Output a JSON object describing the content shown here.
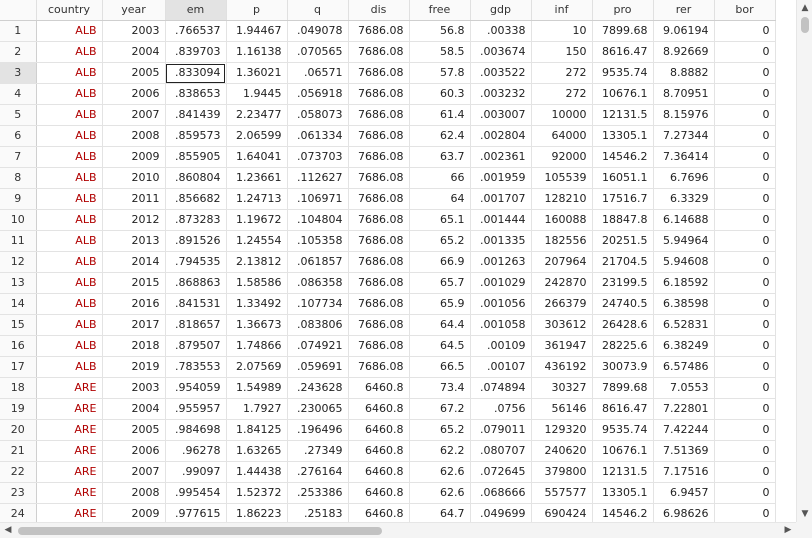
{
  "columns": [
    "country",
    "year",
    "em",
    "p",
    "q",
    "dis",
    "free",
    "gdp",
    "inf",
    "pro",
    "rer",
    "bor"
  ],
  "selected_column": "em",
  "selected_row": 3,
  "active_cell": {
    "row": 3,
    "column": "em"
  },
  "string_color": "#b00000",
  "rows": [
    [
      "1",
      "ALB",
      "2003",
      ".766537",
      "1.94467",
      ".049078",
      "7686.08",
      "56.8",
      ".00338",
      "10",
      "7899.68",
      "9.06194",
      "0"
    ],
    [
      "2",
      "ALB",
      "2004",
      ".839703",
      "1.16138",
      ".070565",
      "7686.08",
      "58.5",
      ".003674",
      "150",
      "8616.47",
      "8.92669",
      "0"
    ],
    [
      "3",
      "ALB",
      "2005",
      ".833094",
      "1.36021",
      ".06571",
      "7686.08",
      "57.8",
      ".003522",
      "272",
      "9535.74",
      "8.8882",
      "0"
    ],
    [
      "4",
      "ALB",
      "2006",
      ".838653",
      "1.9445",
      ".056918",
      "7686.08",
      "60.3",
      ".003232",
      "272",
      "10676.1",
      "8.70951",
      "0"
    ],
    [
      "5",
      "ALB",
      "2007",
      ".841439",
      "2.23477",
      ".058073",
      "7686.08",
      "61.4",
      ".003007",
      "10000",
      "12131.5",
      "8.15976",
      "0"
    ],
    [
      "6",
      "ALB",
      "2008",
      ".859573",
      "2.06599",
      ".061334",
      "7686.08",
      "62.4",
      ".002804",
      "64000",
      "13305.1",
      "7.27344",
      "0"
    ],
    [
      "7",
      "ALB",
      "2009",
      ".855905",
      "1.64041",
      ".073703",
      "7686.08",
      "63.7",
      ".002361",
      "92000",
      "14546.2",
      "7.36414",
      "0"
    ],
    [
      "8",
      "ALB",
      "2010",
      ".860804",
      "1.23661",
      ".112627",
      "7686.08",
      "66",
      ".001959",
      "105539",
      "16051.1",
      "6.7696",
      "0"
    ],
    [
      "9",
      "ALB",
      "2011",
      ".856682",
      "1.24713",
      ".106971",
      "7686.08",
      "64",
      ".001707",
      "128210",
      "17516.7",
      "6.3329",
      "0"
    ],
    [
      "10",
      "ALB",
      "2012",
      ".873283",
      "1.19672",
      ".104804",
      "7686.08",
      "65.1",
      ".001444",
      "160088",
      "18847.8",
      "6.14688",
      "0"
    ],
    [
      "11",
      "ALB",
      "2013",
      ".891526",
      "1.24554",
      ".105358",
      "7686.08",
      "65.2",
      ".001335",
      "182556",
      "20251.5",
      "5.94964",
      "0"
    ],
    [
      "12",
      "ALB",
      "2014",
      ".794535",
      "2.13812",
      ".061857",
      "7686.08",
      "66.9",
      ".001263",
      "207964",
      "21704.5",
      "5.94608",
      "0"
    ],
    [
      "13",
      "ALB",
      "2015",
      ".868863",
      "1.58586",
      ".086358",
      "7686.08",
      "65.7",
      ".001029",
      "242870",
      "23199.5",
      "6.18592",
      "0"
    ],
    [
      "14",
      "ALB",
      "2016",
      ".841531",
      "1.33492",
      ".107734",
      "7686.08",
      "65.9",
      ".001056",
      "266379",
      "24740.5",
      "6.38598",
      "0"
    ],
    [
      "15",
      "ALB",
      "2017",
      ".818657",
      "1.36673",
      ".083806",
      "7686.08",
      "64.4",
      ".001058",
      "303612",
      "26428.6",
      "6.52831",
      "0"
    ],
    [
      "16",
      "ALB",
      "2018",
      ".879507",
      "1.74866",
      ".074921",
      "7686.08",
      "64.5",
      ".00109",
      "361947",
      "28225.6",
      "6.38249",
      "0"
    ],
    [
      "17",
      "ALB",
      "2019",
      ".783553",
      "2.07569",
      ".059691",
      "7686.08",
      "66.5",
      ".00107",
      "436192",
      "30073.9",
      "6.57486",
      "0"
    ],
    [
      "18",
      "ARE",
      "2003",
      ".954059",
      "1.54989",
      ".243628",
      "6460.8",
      "73.4",
      ".074894",
      "30327",
      "7899.68",
      "7.0553",
      "0"
    ],
    [
      "19",
      "ARE",
      "2004",
      ".955957",
      "1.7927",
      ".230065",
      "6460.8",
      "67.2",
      ".0756",
      "56146",
      "8616.47",
      "7.22801",
      "0"
    ],
    [
      "20",
      "ARE",
      "2005",
      ".984698",
      "1.84125",
      ".196496",
      "6460.8",
      "65.2",
      ".079011",
      "129320",
      "9535.74",
      "7.42244",
      "0"
    ],
    [
      "21",
      "ARE",
      "2006",
      ".96278",
      "1.63265",
      ".27349",
      "6460.8",
      "62.2",
      ".080707",
      "240620",
      "10676.1",
      "7.51369",
      "0"
    ],
    [
      "22",
      "ARE",
      "2007",
      ".99097",
      "1.44438",
      ".276164",
      "6460.8",
      "62.6",
      ".072645",
      "379800",
      "12131.5",
      "7.17516",
      "0"
    ],
    [
      "23",
      "ARE",
      "2008",
      ".995454",
      "1.52372",
      ".253386",
      "6460.8",
      "62.6",
      ".068666",
      "557577",
      "13305.1",
      "6.9457",
      "0"
    ],
    [
      "24",
      "ARE",
      "2009",
      ".977615",
      "1.86223",
      ".25183",
      "6460.8",
      "64.7",
      ".049699",
      "690424",
      "14546.2",
      "6.98626",
      "0"
    ]
  ],
  "scrollbars": {
    "up_icon": "triangle-up-icon",
    "down_icon": "triangle-down-icon",
    "left_icon": "triangle-left-icon",
    "right_icon": "triangle-right-icon"
  }
}
